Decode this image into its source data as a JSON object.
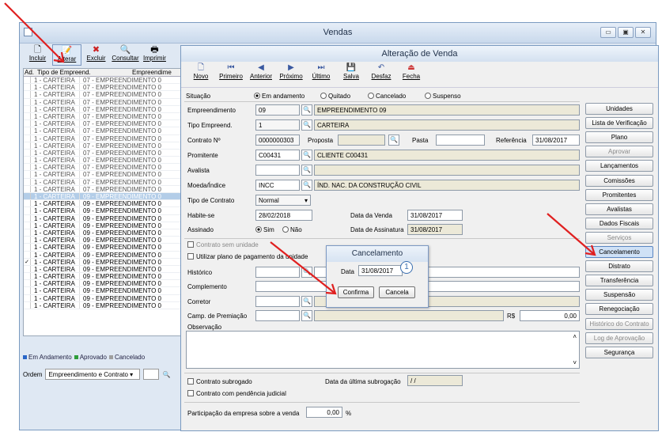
{
  "bg_window": {
    "title": "Vendas",
    "toolbar": [
      {
        "label": "Incluir",
        "icon": "new-doc-icon"
      },
      {
        "label": "Alterar",
        "icon": "edit-doc-icon"
      },
      {
        "label": "Excluir",
        "icon": "delete-x-icon"
      },
      {
        "label": "Consultar",
        "icon": "magnifier-icon"
      },
      {
        "label": "Imprimir",
        "icon": "printer-icon"
      }
    ],
    "controls": [
      "▭",
      "▣",
      "✕"
    ]
  },
  "grid": {
    "headers": [
      "Ad.",
      "Tipo de Empreend.",
      "Empreendime"
    ],
    "rows": [
      {
        "check": "",
        "tipo": "1 - CARTEIRA",
        "emp": "07 - EMPREENDIMENTO 0",
        "style": "g"
      },
      {
        "check": "",
        "tipo": "1 - CARTEIRA",
        "emp": "07 - EMPREENDIMENTO 0",
        "style": "g"
      },
      {
        "check": "",
        "tipo": "1 - CARTEIRA",
        "emp": "07 - EMPREENDIMENTO 0",
        "style": "g"
      },
      {
        "check": "",
        "tipo": "1 - CARTEIRA",
        "emp": "07 - EMPREENDIMENTO 0",
        "style": "g"
      },
      {
        "check": "",
        "tipo": "1 - CARTEIRA",
        "emp": "07 - EMPREENDIMENTO 0",
        "style": "g"
      },
      {
        "check": "",
        "tipo": "1 - CARTEIRA",
        "emp": "07 - EMPREENDIMENTO 0",
        "style": "g"
      },
      {
        "check": "",
        "tipo": "1 - CARTEIRA",
        "emp": "07 - EMPREENDIMENTO 0",
        "style": "g"
      },
      {
        "check": "",
        "tipo": "1 - CARTEIRA",
        "emp": "07 - EMPREENDIMENTO 0",
        "style": "g"
      },
      {
        "check": "",
        "tipo": "1 - CARTEIRA",
        "emp": "07 - EMPREENDIMENTO 0",
        "style": "g"
      },
      {
        "check": "",
        "tipo": "1 - CARTEIRA",
        "emp": "07 - EMPREENDIMENTO 0",
        "style": "g"
      },
      {
        "check": "",
        "tipo": "1 - CARTEIRA",
        "emp": "07 - EMPREENDIMENTO 0",
        "style": "g"
      },
      {
        "check": "",
        "tipo": "1 - CARTEIRA",
        "emp": "07 - EMPREENDIMENTO 0",
        "style": "g"
      },
      {
        "check": "",
        "tipo": "1 - CARTEIRA",
        "emp": "07 - EMPREENDIMENTO 0",
        "style": "g"
      },
      {
        "check": "",
        "tipo": "1 - CARTEIRA",
        "emp": "07 - EMPREENDIMENTO 0",
        "style": "g"
      },
      {
        "check": "",
        "tipo": "1 - CARTEIRA",
        "emp": "07 - EMPREENDIMENTO 0",
        "style": "g"
      },
      {
        "check": "",
        "tipo": "1 - CARTEIRA",
        "emp": "07 - EMPREENDIMENTO 0",
        "style": "g"
      },
      {
        "check": "",
        "tipo": "1 - CARTEIRA",
        "emp": "09 - EMPREENDIMENTO 0",
        "style": "hl"
      },
      {
        "check": "",
        "tipo": "1 - CARTEIRA",
        "emp": "09 - EMPREENDIMENTO 0",
        "style": "dk"
      },
      {
        "check": "",
        "tipo": "1 - CARTEIRA",
        "emp": "09 - EMPREENDIMENTO 0",
        "style": "dk"
      },
      {
        "check": "",
        "tipo": "1 - CARTEIRA",
        "emp": "09 - EMPREENDIMENTO 0",
        "style": "dk"
      },
      {
        "check": "",
        "tipo": "1 - CARTEIRA",
        "emp": "09 - EMPREENDIMENTO 0",
        "style": "dk"
      },
      {
        "check": "",
        "tipo": "1 - CARTEIRA",
        "emp": "09 - EMPREENDIMENTO 0",
        "style": "dk"
      },
      {
        "check": "",
        "tipo": "1 - CARTEIRA",
        "emp": "09 - EMPREENDIMENTO 0",
        "style": "dk"
      },
      {
        "check": "",
        "tipo": "1 - CARTEIRA",
        "emp": "09 - EMPREENDIMENTO 0",
        "style": "dk"
      },
      {
        "check": "",
        "tipo": "1 - CARTEIRA",
        "emp": "09 - EMPREENDIMENTO 0",
        "style": "dk"
      },
      {
        "check": "✓",
        "tipo": "1 - CARTEIRA",
        "emp": "09 - EMPREENDIMENTO 0",
        "style": "dk"
      },
      {
        "check": "",
        "tipo": "1 - CARTEIRA",
        "emp": "09 - EMPREENDIMENTO 0",
        "style": "dk"
      },
      {
        "check": "",
        "tipo": "1 - CARTEIRA",
        "emp": "09 - EMPREENDIMENTO 0",
        "style": "dk"
      },
      {
        "check": "",
        "tipo": "1 - CARTEIRA",
        "emp": "09 - EMPREENDIMENTO 0",
        "style": "dk"
      },
      {
        "check": "",
        "tipo": "1 - CARTEIRA",
        "emp": "09 - EMPREENDIMENTO 0",
        "style": "dk"
      },
      {
        "check": "",
        "tipo": "1 - CARTEIRA",
        "emp": "09 - EMPREENDIMENTO 0",
        "style": "dk"
      },
      {
        "check": "",
        "tipo": "1 - CARTEIRA",
        "emp": "09 - EMPREENDIMENTO 0",
        "style": "dk"
      }
    ]
  },
  "legend": [
    {
      "label": "Em Andamento",
      "color": "#2a66c8"
    },
    {
      "label": "Aprovado",
      "color": "#2e9d3a"
    },
    {
      "label": "Cancelado",
      "color": "#9e9e9e"
    }
  ],
  "ordem": {
    "label": "Ordem",
    "value": "Empreendimento e Contrato"
  },
  "main": {
    "title": "Alteração de Venda",
    "toolbar": [
      {
        "label": "Novo",
        "icon": "new-doc-icon"
      },
      {
        "label": "Primeiro",
        "icon": "first-icon"
      },
      {
        "label": "Anterior",
        "icon": "prev-icon"
      },
      {
        "label": "Próximo",
        "icon": "next-icon"
      },
      {
        "label": "Último",
        "icon": "last-icon"
      },
      {
        "label": "Salva",
        "icon": "save-icon"
      },
      {
        "label": "Desfaz",
        "icon": "undo-icon"
      },
      {
        "label": "Fecha",
        "icon": "exit-icon"
      }
    ],
    "situacao": {
      "label": "Situação",
      "options": [
        "Em andamento",
        "Quitado",
        "Cancelado",
        "Suspenso"
      ]
    },
    "labels": {
      "empreendimento": "Empreendimento",
      "tipo": "Tipo Empreend.",
      "contrato": "Contrato Nº",
      "proposta": "Proposta",
      "pasta": "Pasta",
      "referencia": "Referência",
      "promitente": "Promitente",
      "avalista": "Avalista",
      "moeda": "Moeda/Índice",
      "tipo_contrato": "Tipo de Contrato",
      "habite": "Habite-se",
      "data_venda": "Data da Venda",
      "assinado": "Assinado",
      "sim": "Sim",
      "nao": "Não",
      "data_assin": "Data de Assinatura",
      "sem_unidade": "Contrato sem unidade",
      "plano": "Utilizar plano de pagamento da unidade",
      "historico": "Histórico",
      "complemento": "Complemento",
      "corretor": "Corretor",
      "premiacao": "Camp. de Premiação",
      "rs": "R$",
      "observacao": "Observação",
      "subrogado": "Contrato subrogado",
      "ultima_sub": "Data da última subrogação",
      "pendencia": "Contrato com pendência judicial",
      "participacao": "Participação da empresa sobre a venda",
      "pct": "%"
    },
    "values": {
      "emp_code": "09",
      "emp_name": "EMPREENDIMENTO 09",
      "tipo_code": "1",
      "tipo_name": "CARTEIRA",
      "contrato": "0000000303",
      "referencia": "31/08/2017",
      "prom_code": "C00431",
      "prom_name": "CLIENTE C00431",
      "moeda_code": "INCC",
      "moeda_name": "ÍND. NAC. DA CONSTRUÇÃO CIVIL",
      "tipo_contrato": "Normal",
      "habite": "28/02/2018",
      "data_venda": "31/08/2017",
      "data_assin": "31/08/2017",
      "premio_val": "0,00",
      "ultima_sub": " / /",
      "participacao": "0,00"
    },
    "side_buttons": [
      {
        "label": "Unidades",
        "dis": false
      },
      {
        "label": "Lista de Verificação",
        "dis": false
      },
      {
        "label": "Plano",
        "dis": false
      },
      {
        "label": "Aprovar",
        "dis": true
      },
      {
        "label": "Lançamentos",
        "dis": false
      },
      {
        "label": "Comissões",
        "dis": false
      },
      {
        "label": "Promitentes",
        "dis": false
      },
      {
        "label": "Avalistas",
        "dis": false
      },
      {
        "label": "Dados Fiscais",
        "dis": false
      },
      {
        "label": "Serviços",
        "dis": true
      },
      {
        "label": "Cancelamento",
        "dis": false
      },
      {
        "label": "Distrato",
        "dis": false
      },
      {
        "label": "Transferência",
        "dis": false
      },
      {
        "label": "Suspensão",
        "dis": false
      },
      {
        "label": "Renegociação",
        "dis": false
      },
      {
        "label": "Histórico do Contrato",
        "dis": true
      },
      {
        "label": "Log de Aprovação",
        "dis": true
      },
      {
        "label": "Segurança",
        "dis": false
      }
    ]
  },
  "dialog": {
    "title": "Cancelamento",
    "data_label": "Data",
    "data_value": "31/08/2017",
    "confirm": "Confirma",
    "cancel": "Cancela"
  },
  "badge": "1"
}
